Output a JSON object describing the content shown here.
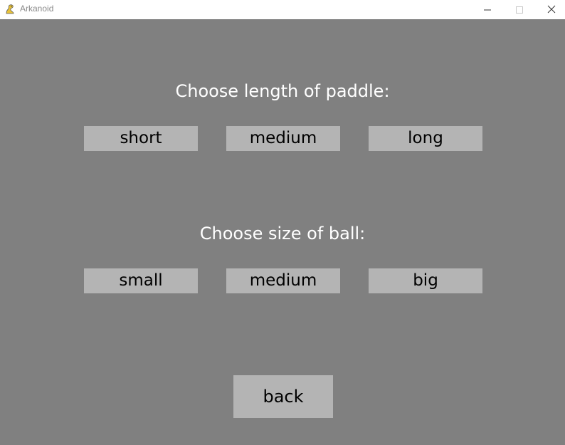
{
  "window": {
    "title": "Arkanoid",
    "icon": "snake-icon",
    "controls": [
      "minimize-icon",
      "maximize-icon",
      "close-icon"
    ]
  },
  "paddle": {
    "heading": "Choose length of paddle:",
    "options": [
      "short",
      "medium",
      "long"
    ]
  },
  "ball": {
    "heading": "Choose size of ball:",
    "options": [
      "small",
      "medium",
      "big"
    ]
  },
  "back_label": "back",
  "colors": {
    "background": "#808080",
    "button": "#b4b4b4",
    "heading_text": "#ffffff",
    "button_text": "#000000"
  }
}
